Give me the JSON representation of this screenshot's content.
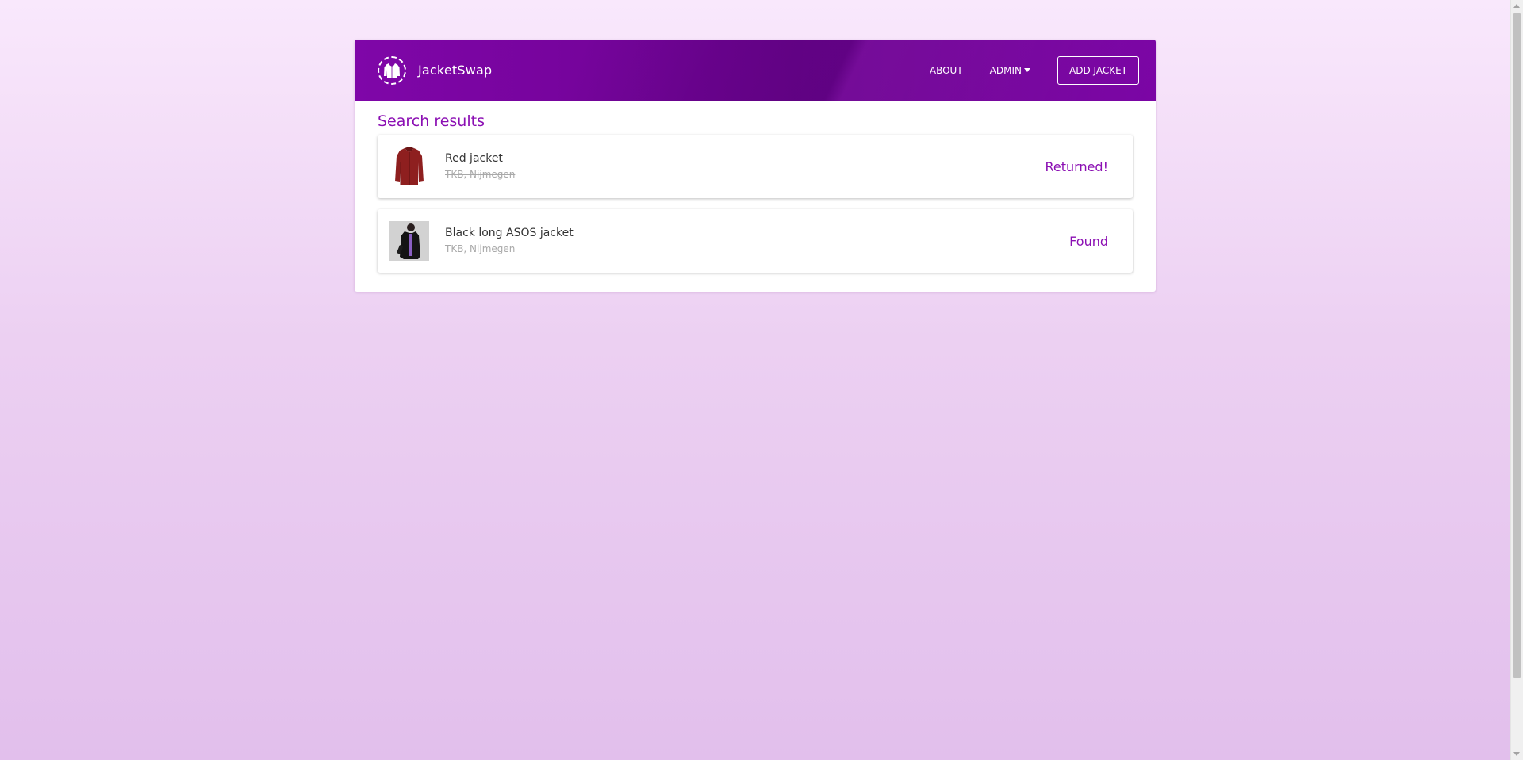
{
  "header": {
    "brand_name": "JacketSwap",
    "logo_icon": "jacket-icon",
    "nav": {
      "about_label": "ABOUT",
      "admin_label": "ADMIN",
      "add_jacket_label": "ADD JACKET"
    }
  },
  "main": {
    "section_title": "Search results",
    "results": [
      {
        "title": "Red jacket",
        "location": "TKB, Nijmegen",
        "status": "Returned!",
        "image_icon": "red-jacket-image"
      },
      {
        "title": "Black long ASOS jacket",
        "location": "TKB, Nijmegen",
        "status": "Found",
        "image_icon": "black-jacket-image"
      }
    ]
  },
  "colors": {
    "brand_purple": "#7a04a3",
    "accent_purple": "#8b0fb3",
    "background_top": "#f9e8fc",
    "background_bottom": "#e2bfec"
  }
}
